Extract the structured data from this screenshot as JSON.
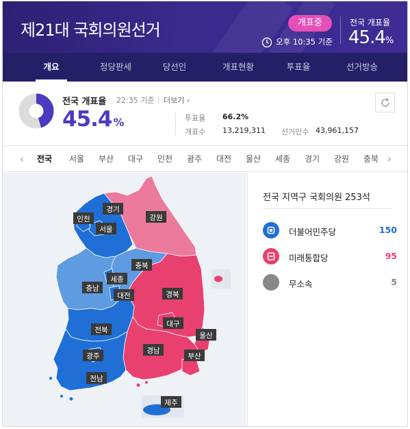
{
  "header": {
    "title": "제21대 국회의원선거",
    "status_badge": "개표중",
    "as_of": "오후 10:35 기준",
    "rate_label": "전국 개표율",
    "rate_value": "45.4",
    "rate_unit": "%"
  },
  "nav": {
    "items": [
      {
        "label": "개요",
        "active": true
      },
      {
        "label": "정당판세",
        "active": false
      },
      {
        "label": "당선인",
        "active": false
      },
      {
        "label": "개표현황",
        "active": false
      },
      {
        "label": "투표율",
        "active": false
      },
      {
        "label": "선거방송",
        "active": false
      }
    ]
  },
  "summary": {
    "title": "전국 개표율",
    "time": "22:35 기준",
    "more": "더보기 ›",
    "big_value": "45.4",
    "big_unit": "%",
    "counting_progress": 0.454,
    "turnout_label": "투표율",
    "turnout_value": "66.2%",
    "counted_label": "개표수",
    "counted_value": "13,219,311",
    "voters_label": "선거인수",
    "voters_value": "43,961,157"
  },
  "region_tabs": [
    "전국",
    "서울",
    "부산",
    "대구",
    "인천",
    "광주",
    "대전",
    "울산",
    "세종",
    "경기",
    "강원",
    "충북"
  ],
  "map": {
    "labels": {
      "gyeonggi": "경기",
      "incheon": "인천",
      "seoul": "서울",
      "gangwon": "강원",
      "chungbuk": "충북",
      "sejong": "세종",
      "chungnam": "충남",
      "daejeon": "대전",
      "gyeongbuk": "경북",
      "daegu": "대구",
      "jeonbuk": "전북",
      "ulsan": "울산",
      "gwangju": "광주",
      "gyeongnam": "경남",
      "busan": "부산",
      "jeonnam": "전남",
      "jeju": "제주"
    },
    "colors": {
      "dem": "#1f6fd6",
      "dem_light": "#5e9be0",
      "upc": "#e8406f",
      "upc_light": "#ec7a9c",
      "label_bg": "#3a3a3a"
    }
  },
  "panel": {
    "title": "전국 지역구 국회의원 253석",
    "parties": [
      {
        "name": "더불어민주당",
        "seats": "150",
        "color": "#1f6fd6",
        "icon": "dem-logo-icon"
      },
      {
        "name": "미래통합당",
        "seats": "95",
        "color": "#e8406f",
        "icon": "upc-logo-icon"
      },
      {
        "name": "무소속",
        "seats": "5",
        "color": "#888888",
        "icon": "independent-icon"
      }
    ]
  }
}
